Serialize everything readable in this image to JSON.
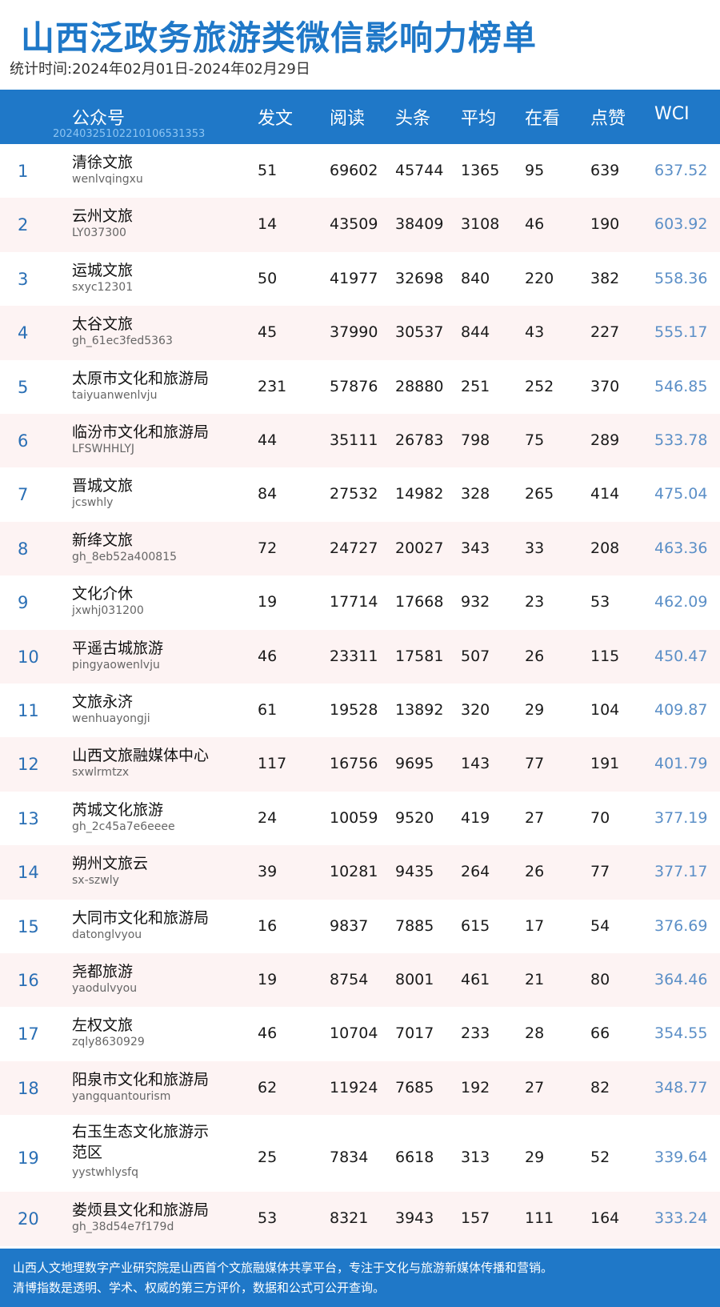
{
  "page": {
    "title": "山西泛政务旅游类微信影响力榜单",
    "period": "统计时间:2024年02月01日-2024年02月29日"
  },
  "header": {
    "account": "公众号",
    "code": "20240325102210106531353",
    "posts": "发文",
    "reads": "阅读",
    "headline": "头条",
    "average": "平均",
    "watching": "在看",
    "likes": "点赞",
    "wci": "WCI"
  },
  "rows": [
    {
      "rank": "1",
      "name": "清徐文旅",
      "account": "wenlvqingxu",
      "posts": "51",
      "reads": "69602",
      "headline": "45744",
      "average": "1365",
      "watching": "95",
      "likes": "639",
      "wci": "637.52"
    },
    {
      "rank": "2",
      "name": "云州文旅",
      "account": "LY037300",
      "posts": "14",
      "reads": "43509",
      "headline": "38409",
      "average": "3108",
      "watching": "46",
      "likes": "190",
      "wci": "603.92"
    },
    {
      "rank": "3",
      "name": "运城文旅",
      "account": "sxyc12301",
      "posts": "50",
      "reads": "41977",
      "headline": "32698",
      "average": "840",
      "watching": "220",
      "likes": "382",
      "wci": "558.36"
    },
    {
      "rank": "4",
      "name": "太谷文旅",
      "account": "gh_61ec3fed5363",
      "posts": "45",
      "reads": "37990",
      "headline": "30537",
      "average": "844",
      "watching": "43",
      "likes": "227",
      "wci": "555.17"
    },
    {
      "rank": "5",
      "name": "太原市文化和旅游局",
      "account": "taiyuanwenlvju",
      "posts": "231",
      "reads": "57876",
      "headline": "28880",
      "average": "251",
      "watching": "252",
      "likes": "370",
      "wci": "546.85"
    },
    {
      "rank": "6",
      "name": "临汾市文化和旅游局",
      "account": "LFSWHHLYJ",
      "posts": "44",
      "reads": "35111",
      "headline": "26783",
      "average": "798",
      "watching": "75",
      "likes": "289",
      "wci": "533.78"
    },
    {
      "rank": "7",
      "name": "晋城文旅",
      "account": "jcswhly",
      "posts": "84",
      "reads": "27532",
      "headline": "14982",
      "average": "328",
      "watching": "265",
      "likes": "414",
      "wci": "475.04"
    },
    {
      "rank": "8",
      "name": "新绛文旅",
      "account": "gh_8eb52a400815",
      "posts": "72",
      "reads": "24727",
      "headline": "20027",
      "average": "343",
      "watching": "33",
      "likes": "208",
      "wci": "463.36"
    },
    {
      "rank": "9",
      "name": "文化介休",
      "account": "jxwhj031200",
      "posts": "19",
      "reads": "17714",
      "headline": "17668",
      "average": "932",
      "watching": "23",
      "likes": "53",
      "wci": "462.09"
    },
    {
      "rank": "10",
      "name": "平遥古城旅游",
      "account": "pingyaowenlvju",
      "posts": "46",
      "reads": "23311",
      "headline": "17581",
      "average": "507",
      "watching": "26",
      "likes": "115",
      "wci": "450.47"
    },
    {
      "rank": "11",
      "name": "文旅永济",
      "account": "wenhuayongji",
      "posts": "61",
      "reads": "19528",
      "headline": "13892",
      "average": "320",
      "watching": "29",
      "likes": "104",
      "wci": "409.87"
    },
    {
      "rank": "12",
      "name": "山西文旅融媒体中心",
      "account": "sxwlrmtzx",
      "posts": "117",
      "reads": "16756",
      "headline": "9695",
      "average": "143",
      "watching": "77",
      "likes": "191",
      "wci": "401.79"
    },
    {
      "rank": "13",
      "name": "芮城文化旅游",
      "account": "gh_2c45a7e6eeee",
      "posts": "24",
      "reads": "10059",
      "headline": "9520",
      "average": "419",
      "watching": "27",
      "likes": "70",
      "wci": "377.19"
    },
    {
      "rank": "14",
      "name": "朔州文旅云",
      "account": "sx-szwly",
      "posts": "39",
      "reads": "10281",
      "headline": "9435",
      "average": "264",
      "watching": "26",
      "likes": "77",
      "wci": "377.17"
    },
    {
      "rank": "15",
      "name": "大同市文化和旅游局",
      "account": "datonglvyou",
      "posts": "16",
      "reads": "9837",
      "headline": "7885",
      "average": "615",
      "watching": "17",
      "likes": "54",
      "wci": "376.69"
    },
    {
      "rank": "16",
      "name": "尧都旅游",
      "account": "yaodulvyou",
      "posts": "19",
      "reads": "8754",
      "headline": "8001",
      "average": "461",
      "watching": "21",
      "likes": "80",
      "wci": "364.46"
    },
    {
      "rank": "17",
      "name": "左权文旅",
      "account": "zqly8630929",
      "posts": "46",
      "reads": "10704",
      "headline": "7017",
      "average": "233",
      "watching": "28",
      "likes": "66",
      "wci": "354.55"
    },
    {
      "rank": "18",
      "name": "阳泉市文化和旅游局",
      "account": "yangquantourism",
      "posts": "62",
      "reads": "11924",
      "headline": "7685",
      "average": "192",
      "watching": "27",
      "likes": "82",
      "wci": "348.77"
    },
    {
      "rank": "19",
      "name": "右玉生态文化旅游示",
      "name2": "范区",
      "account": "yystwhlysfq",
      "posts": "25",
      "reads": "7834",
      "headline": "6618",
      "average": "313",
      "watching": "29",
      "likes": "52",
      "wci": "339.64"
    },
    {
      "rank": "20",
      "name": "娄烦县文化和旅游局",
      "account": "gh_38d54e7f179d",
      "posts": "53",
      "reads": "8321",
      "headline": "3943",
      "average": "157",
      "watching": "111",
      "likes": "164",
      "wci": "333.24"
    }
  ],
  "footer": {
    "line1": "山西人文地理数字产业研究院是山西首个文旅融媒体共享平台，专注于文化与旅游新媒体传播和营销。",
    "line2": "清博指数是透明、学术、权威的第三方评价，数据和公式可公开查询。"
  },
  "colors": {
    "accent": "#1f78c8",
    "row_alt": "#fdf3f3",
    "wci": "#5b8fc7"
  }
}
